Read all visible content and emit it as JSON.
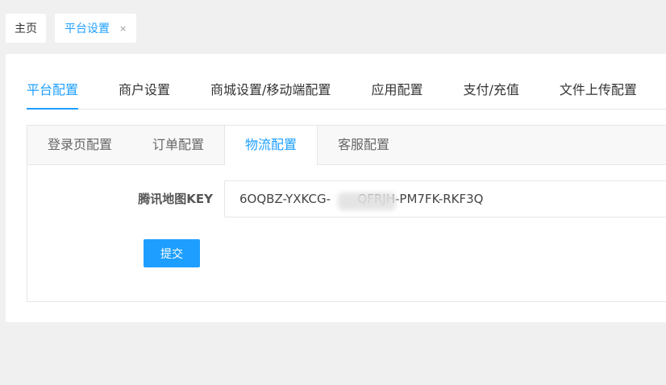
{
  "page_tabs": [
    {
      "label": "主页"
    },
    {
      "label": "平台设置",
      "close": "×"
    }
  ],
  "main_tabs": [
    {
      "label": "平台配置"
    },
    {
      "label": "商户设置"
    },
    {
      "label": "商城设置/移动端配置"
    },
    {
      "label": "应用配置"
    },
    {
      "label": "支付/充值"
    },
    {
      "label": "文件上传配置"
    }
  ],
  "active_main_tab": "平台配置",
  "sub_tabs": [
    {
      "label": "登录页配置"
    },
    {
      "label": "订单配置"
    },
    {
      "label": "物流配置"
    },
    {
      "label": "客服配置"
    }
  ],
  "active_sub_tab": "物流配置",
  "form": {
    "label": "腾讯地图KEY",
    "value": "6OQBZ-YXKCG-       QFRJH-PM7FK-RKF3Q",
    "submit_label": "提交"
  },
  "colors": {
    "accent": "#1e9fff"
  }
}
